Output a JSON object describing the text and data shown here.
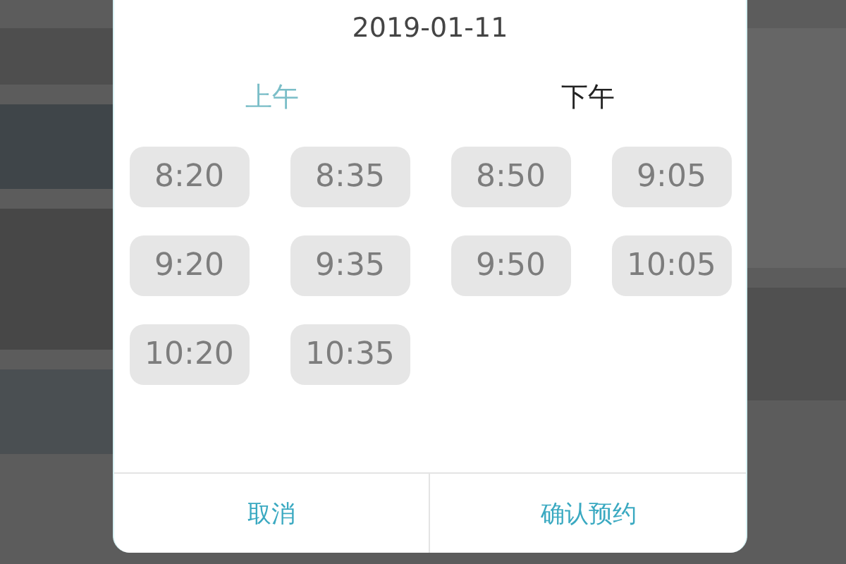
{
  "dialog": {
    "date": "2019-01-11",
    "tabs": [
      {
        "label": "上午",
        "selected": true
      },
      {
        "label": "下午",
        "selected": false
      }
    ],
    "slots": [
      {
        "time": "8:20",
        "disabled": true
      },
      {
        "time": "8:35",
        "disabled": true
      },
      {
        "time": "8:50",
        "disabled": true
      },
      {
        "time": "9:05",
        "disabled": true
      },
      {
        "time": "9:20",
        "disabled": true
      },
      {
        "time": "9:35",
        "disabled": true
      },
      {
        "time": "9:50",
        "disabled": true
      },
      {
        "time": "10:05",
        "disabled": true
      },
      {
        "time": "10:20",
        "disabled": true
      },
      {
        "time": "10:35",
        "disabled": true
      }
    ],
    "buttons": [
      {
        "label": "取消"
      },
      {
        "label": "确认预约"
      }
    ]
  }
}
